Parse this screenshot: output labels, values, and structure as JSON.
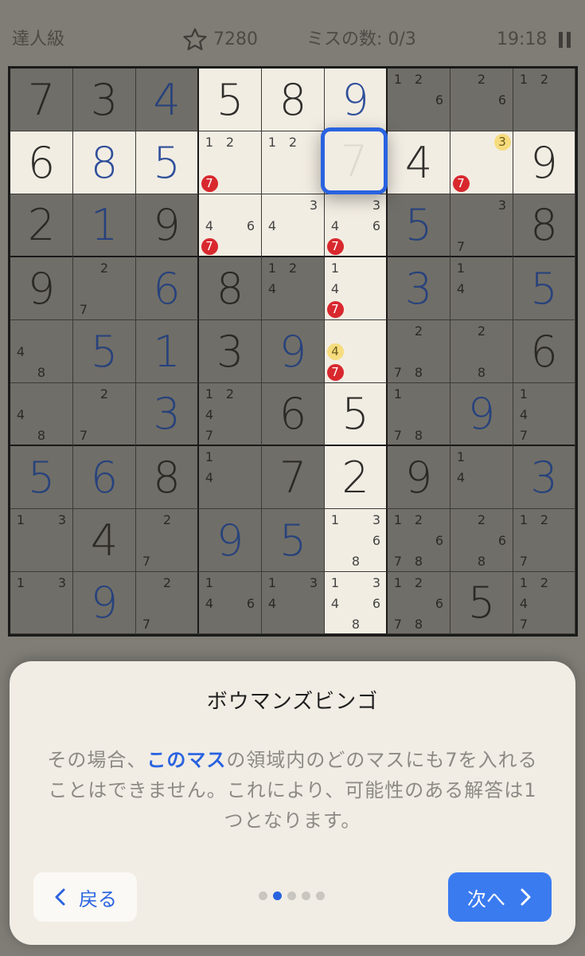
{
  "header": {
    "level": "達人級",
    "score": "7280",
    "mistakes": "ミスの数: 0/3",
    "timer": "19:18",
    "pause_icon": "pause-icon"
  },
  "grid": [
    [
      {
        "v": "7",
        "t": "g"
      },
      {
        "v": "3",
        "t": "g"
      },
      {
        "v": "4",
        "t": "u"
      },
      {
        "v": "5",
        "t": "g",
        "hl": true
      },
      {
        "v": "8",
        "t": "g",
        "hl": true
      },
      {
        "v": "9",
        "t": "u",
        "hl": true
      },
      {
        "n": {
          "1": "1",
          "2": "2",
          "6": "6"
        }
      },
      {
        "n": {
          "2": "2",
          "6": "6"
        }
      },
      {
        "n": {
          "1": "1",
          "2": "2"
        }
      }
    ],
    [
      {
        "v": "6",
        "t": "g",
        "hl": true
      },
      {
        "v": "8",
        "t": "u",
        "hl": true
      },
      {
        "v": "5",
        "t": "u",
        "hl": true
      },
      {
        "n": {
          "1": "1",
          "2": "2"
        },
        "r": {
          "7": "7"
        },
        "hl": true
      },
      {
        "n": {
          "1": "1",
          "2": "2"
        },
        "hl": true
      },
      {
        "sel": true,
        "ghost": "7",
        "hl": true
      },
      {
        "v": "4",
        "t": "g",
        "hl": true
      },
      {
        "y": {
          "3": "3"
        },
        "r": {
          "7": "7"
        },
        "hl": true
      },
      {
        "v": "9",
        "t": "g",
        "hl": true
      }
    ],
    [
      {
        "v": "2",
        "t": "g"
      },
      {
        "v": "1",
        "t": "u"
      },
      {
        "v": "9",
        "t": "g"
      },
      {
        "n": {
          "4": "4",
          "6": "6"
        },
        "r": {
          "7": "7"
        },
        "hl": true
      },
      {
        "n": {
          "3": "3",
          "4": "4"
        },
        "hl": true
      },
      {
        "n": {
          "3": "3",
          "4": "4",
          "6": "6"
        },
        "r": {
          "7": "7"
        },
        "hl": true
      },
      {
        "v": "5",
        "t": "u"
      },
      {
        "n": {
          "3": "3",
          "7": "7"
        }
      },
      {
        "v": "8",
        "t": "g"
      }
    ],
    [
      {
        "v": "9",
        "t": "g"
      },
      {
        "n": {
          "2": "2",
          "7": "7"
        }
      },
      {
        "v": "6",
        "t": "u"
      },
      {
        "v": "8",
        "t": "g"
      },
      {
        "n": {
          "1": "1",
          "2": "2",
          "4": "4"
        }
      },
      {
        "n": {
          "1": "1",
          "4": "4"
        },
        "r": {
          "7": "7"
        },
        "hl": true
      },
      {
        "v": "3",
        "t": "u"
      },
      {
        "n": {
          "1": "1",
          "4": "4"
        }
      },
      {
        "v": "5",
        "t": "u"
      }
    ],
    [
      {
        "n": {
          "4": "4",
          "8": "8"
        }
      },
      {
        "v": "5",
        "t": "u"
      },
      {
        "v": "1",
        "t": "u"
      },
      {
        "v": "3",
        "t": "g"
      },
      {
        "v": "9",
        "t": "u"
      },
      {
        "y": {
          "4": "4"
        },
        "r": {
          "7": "7"
        },
        "hl": true
      },
      {
        "n": {
          "2": "2",
          "7": "7",
          "8": "8"
        }
      },
      {
        "n": {
          "2": "2",
          "8": "8"
        }
      },
      {
        "v": "6",
        "t": "g"
      }
    ],
    [
      {
        "n": {
          "4": "4",
          "8": "8"
        }
      },
      {
        "n": {
          "2": "2",
          "7": "7"
        }
      },
      {
        "v": "3",
        "t": "u"
      },
      {
        "n": {
          "1": "1",
          "2": "2",
          "4": "4",
          "7": "7"
        }
      },
      {
        "v": "6",
        "t": "g"
      },
      {
        "v": "5",
        "t": "g",
        "hl": true
      },
      {
        "n": {
          "1": "1",
          "7": "7",
          "8": "8"
        }
      },
      {
        "v": "9",
        "t": "u"
      },
      {
        "n": {
          "1": "1",
          "4": "4",
          "7": "7"
        }
      }
    ],
    [
      {
        "v": "5",
        "t": "u"
      },
      {
        "v": "6",
        "t": "u"
      },
      {
        "v": "8",
        "t": "g"
      },
      {
        "n": {
          "1": "1",
          "4": "4"
        }
      },
      {
        "v": "7",
        "t": "g"
      },
      {
        "v": "2",
        "t": "g",
        "hl": true
      },
      {
        "v": "9",
        "t": "g"
      },
      {
        "n": {
          "1": "1",
          "4": "4"
        }
      },
      {
        "v": "3",
        "t": "u"
      }
    ],
    [
      {
        "n": {
          "1": "1",
          "3": "3"
        }
      },
      {
        "v": "4",
        "t": "g"
      },
      {
        "n": {
          "2": "2",
          "7": "7"
        }
      },
      {
        "v": "9",
        "t": "u"
      },
      {
        "v": "5",
        "t": "u"
      },
      {
        "n": {
          "1": "1",
          "3": "3",
          "6": "6",
          "8": "8"
        },
        "hl": true
      },
      {
        "n": {
          "1": "1",
          "2": "2",
          "6": "6",
          "7": "7",
          "8": "8"
        }
      },
      {
        "n": {
          "2": "2",
          "6": "6",
          "8": "8"
        }
      },
      {
        "n": {
          "1": "1",
          "2": "2",
          "7": "7"
        }
      }
    ],
    [
      {
        "n": {
          "1": "1",
          "3": "3"
        }
      },
      {
        "v": "9",
        "t": "u"
      },
      {
        "n": {
          "2": "2",
          "7": "7"
        }
      },
      {
        "n": {
          "1": "1",
          "4": "4",
          "6": "6"
        }
      },
      {
        "n": {
          "1": "1",
          "3": "3",
          "4": "4"
        }
      },
      {
        "n": {
          "1": "1",
          "3": "3",
          "4": "4",
          "6": "6",
          "8": "8"
        },
        "hl": true
      },
      {
        "n": {
          "1": "1",
          "2": "2",
          "6": "6",
          "7": "7",
          "8": "8"
        }
      },
      {
        "v": "5",
        "t": "g"
      },
      {
        "n": {
          "1": "1",
          "2": "2",
          "4": "4",
          "7": "7"
        }
      }
    ]
  ],
  "tutorial": {
    "title": "ボウマンズビンゴ",
    "body_pre": "その場合、",
    "body_highlight": "このマス",
    "body_post": "の領域内のどのマスにも7を入れることはできません。これにより、可能性のある解答は1つとなります。",
    "back_label": "戻る",
    "next_label": "次へ",
    "page_count": 5,
    "active_page": 2
  },
  "colors": {
    "accent": "#2a63e0",
    "next_button": "#3a7bf0",
    "note_red": "#d8282e",
    "note_yellow": "#f6dc7d"
  }
}
